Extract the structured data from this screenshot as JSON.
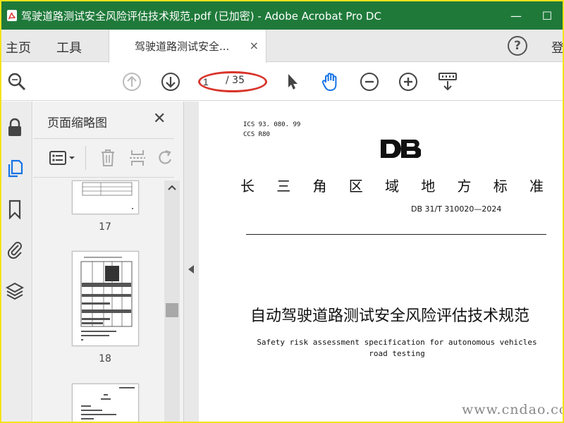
{
  "window": {
    "title": "驾驶道路测试安全风险评估技术规范.pdf  (已加密)  - Adobe Acrobat Pro DC",
    "minimize": "—",
    "maximize": "☐"
  },
  "menu": {
    "home": "主页",
    "tools": "工具",
    "doc_tab_label": "驾驶道路测试安全...",
    "doc_tab_close": "×",
    "help": "?",
    "sign_in": "登"
  },
  "toolbar": {
    "page_current": "1",
    "page_total": "/ 35"
  },
  "thumbnails_panel": {
    "title": "页面缩略图",
    "close": "✕",
    "pages": [
      {
        "number": "17"
      },
      {
        "number": "18"
      }
    ]
  },
  "document": {
    "ics": "ICS  93. 080. 99",
    "ccs": "CCS  R80",
    "logo": "DB",
    "org_chars": [
      "长",
      "三",
      "角",
      "区",
      "域",
      "地",
      "方",
      "标",
      "准"
    ],
    "std_number": "DB 31/T 310020—2024",
    "title_cn": "自动驾驶道路测试安全风险评估技术规范",
    "title_en": "Safety risk assessment specification for autonomous vehicles road testing"
  },
  "watermark": {
    "url": "www.cndao.com"
  },
  "colors": {
    "titlebar": "#1f7a3a",
    "frame_border": "#f4e21a",
    "accent_blue": "#1473e6",
    "highlight_ellipse": "#d8342a"
  }
}
